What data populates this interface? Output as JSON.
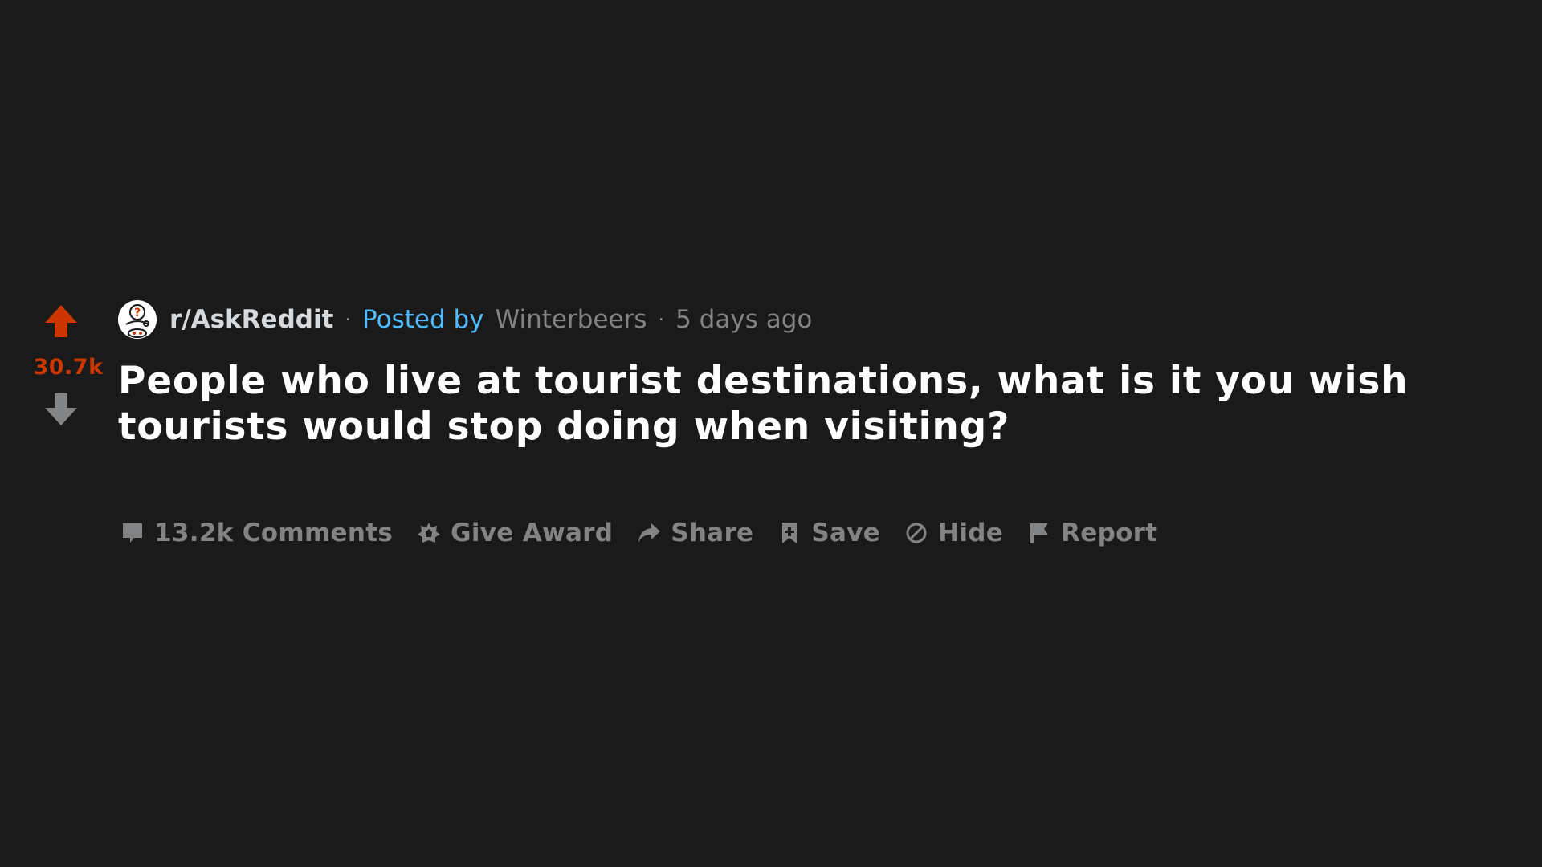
{
  "vote": {
    "count": "30.7k",
    "upvote_icon": "upvote-arrow-icon",
    "downvote_icon": "downvote-arrow-icon",
    "upvote_color": "#cc3700",
    "downvote_color": "#818384"
  },
  "meta": {
    "subreddit_icon": "askreddit-avatar-icon",
    "subreddit": "r/AskReddit",
    "separator": "·",
    "posted_by_label": "Posted by",
    "author": "Winterbeers",
    "time": "5 days ago"
  },
  "post": {
    "title": "People who live at tourist destinations, what is it you wish tourists would stop doing when visiting?"
  },
  "actions": [
    {
      "icon": "comment-icon",
      "label": "13.2k Comments"
    },
    {
      "icon": "award-icon",
      "label": "Give Award"
    },
    {
      "icon": "share-icon",
      "label": "Share"
    },
    {
      "icon": "bookmark-icon",
      "label": "Save"
    },
    {
      "icon": "hide-icon",
      "label": "Hide"
    },
    {
      "icon": "flag-icon",
      "label": "Report"
    }
  ],
  "colors": {
    "background": "#1a1a1b",
    "accent_orange": "#cc3700",
    "link_blue": "#4fbcff",
    "muted": "#818384",
    "title": "#ffffff"
  }
}
